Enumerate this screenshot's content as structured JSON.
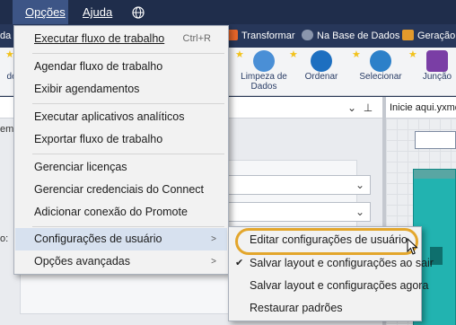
{
  "menubar": {
    "options_label": "Opções",
    "help_label": "Ajuda",
    "globe_icon": "globe-icon"
  },
  "categories": [
    {
      "label": "da",
      "color": "#27375a"
    },
    {
      "label": "Transformar",
      "color": "#e8662a"
    },
    {
      "label": "Na Base de Dados",
      "color": "#8a96ad"
    },
    {
      "label": "Geração d",
      "color": "#e39a2b"
    }
  ],
  "tools": [
    {
      "label": "de",
      "color": "#6b6b6b"
    },
    {
      "label": "Limpeza de Dados",
      "color": "#4a8fd6"
    },
    {
      "label": "Ordenar",
      "color": "#1d6fc0"
    },
    {
      "label": "Selecionar",
      "color": "#2c80c9"
    },
    {
      "label": "Junção",
      "color": "#7a3ea5"
    }
  ],
  "panel": {
    "left_tab_text": "emp",
    "right_tab": "Inicie aqui.yxmd",
    "side_label": "o:"
  },
  "menu_options": {
    "items": [
      {
        "label": "Executar fluxo de trabalho",
        "shortcut": "Ctrl+R"
      },
      {
        "label": "Agendar fluxo de trabalho"
      },
      {
        "label": "Exibir agendamentos"
      },
      {
        "label": "Executar aplicativos analíticos"
      },
      {
        "label": "Exportar fluxo de trabalho"
      },
      {
        "label": "Gerenciar licenças"
      },
      {
        "label": "Gerenciar credenciais do Connect"
      },
      {
        "label": "Adicionar conexão do Promote"
      },
      {
        "label": "Configurações de usuário",
        "arrow": ">"
      },
      {
        "label": "Opções avançadas",
        "arrow": ">"
      }
    ]
  },
  "submenu": {
    "items": [
      {
        "label": "Editar configurações de usuário"
      },
      {
        "label": "Salvar layout e configurações ao sair",
        "check": "✔"
      },
      {
        "label": "Salvar layout e configurações agora"
      },
      {
        "label": "Restaurar padrões"
      }
    ]
  },
  "accent": {
    "highlight_ring": "#e3a62c",
    "menu_bar": "#1f2d4b"
  }
}
